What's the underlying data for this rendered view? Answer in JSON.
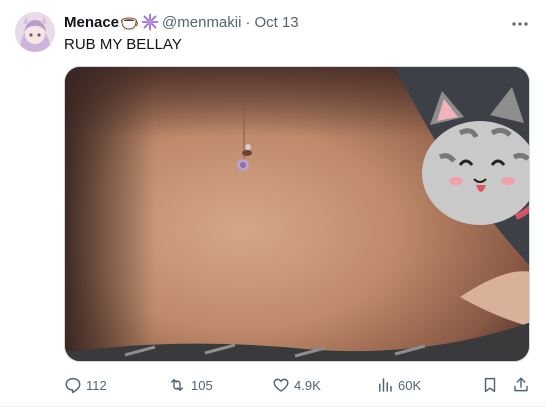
{
  "tweet": {
    "display_name": "Menace",
    "name_emojis": [
      "coffee-cup-emoji",
      "sparkle-star-emoji"
    ],
    "handle": "@menmakii",
    "separator": "·",
    "date": "Oct 13",
    "text": "RUB MY BELLAY"
  },
  "actions": {
    "reply_count": "112",
    "retweet_count": "105",
    "like_count": "4.9K",
    "views_count": "60K"
  },
  "icons": {
    "more": "more-horizontal-icon",
    "reply": "reply-icon",
    "retweet": "retweet-icon",
    "like": "heart-icon",
    "views": "analytics-icon",
    "bookmark": "bookmark-icon",
    "share": "share-icon"
  },
  "colors": {
    "text_primary": "#0f1419",
    "text_secondary": "#536471",
    "border": "#cfd9de"
  }
}
